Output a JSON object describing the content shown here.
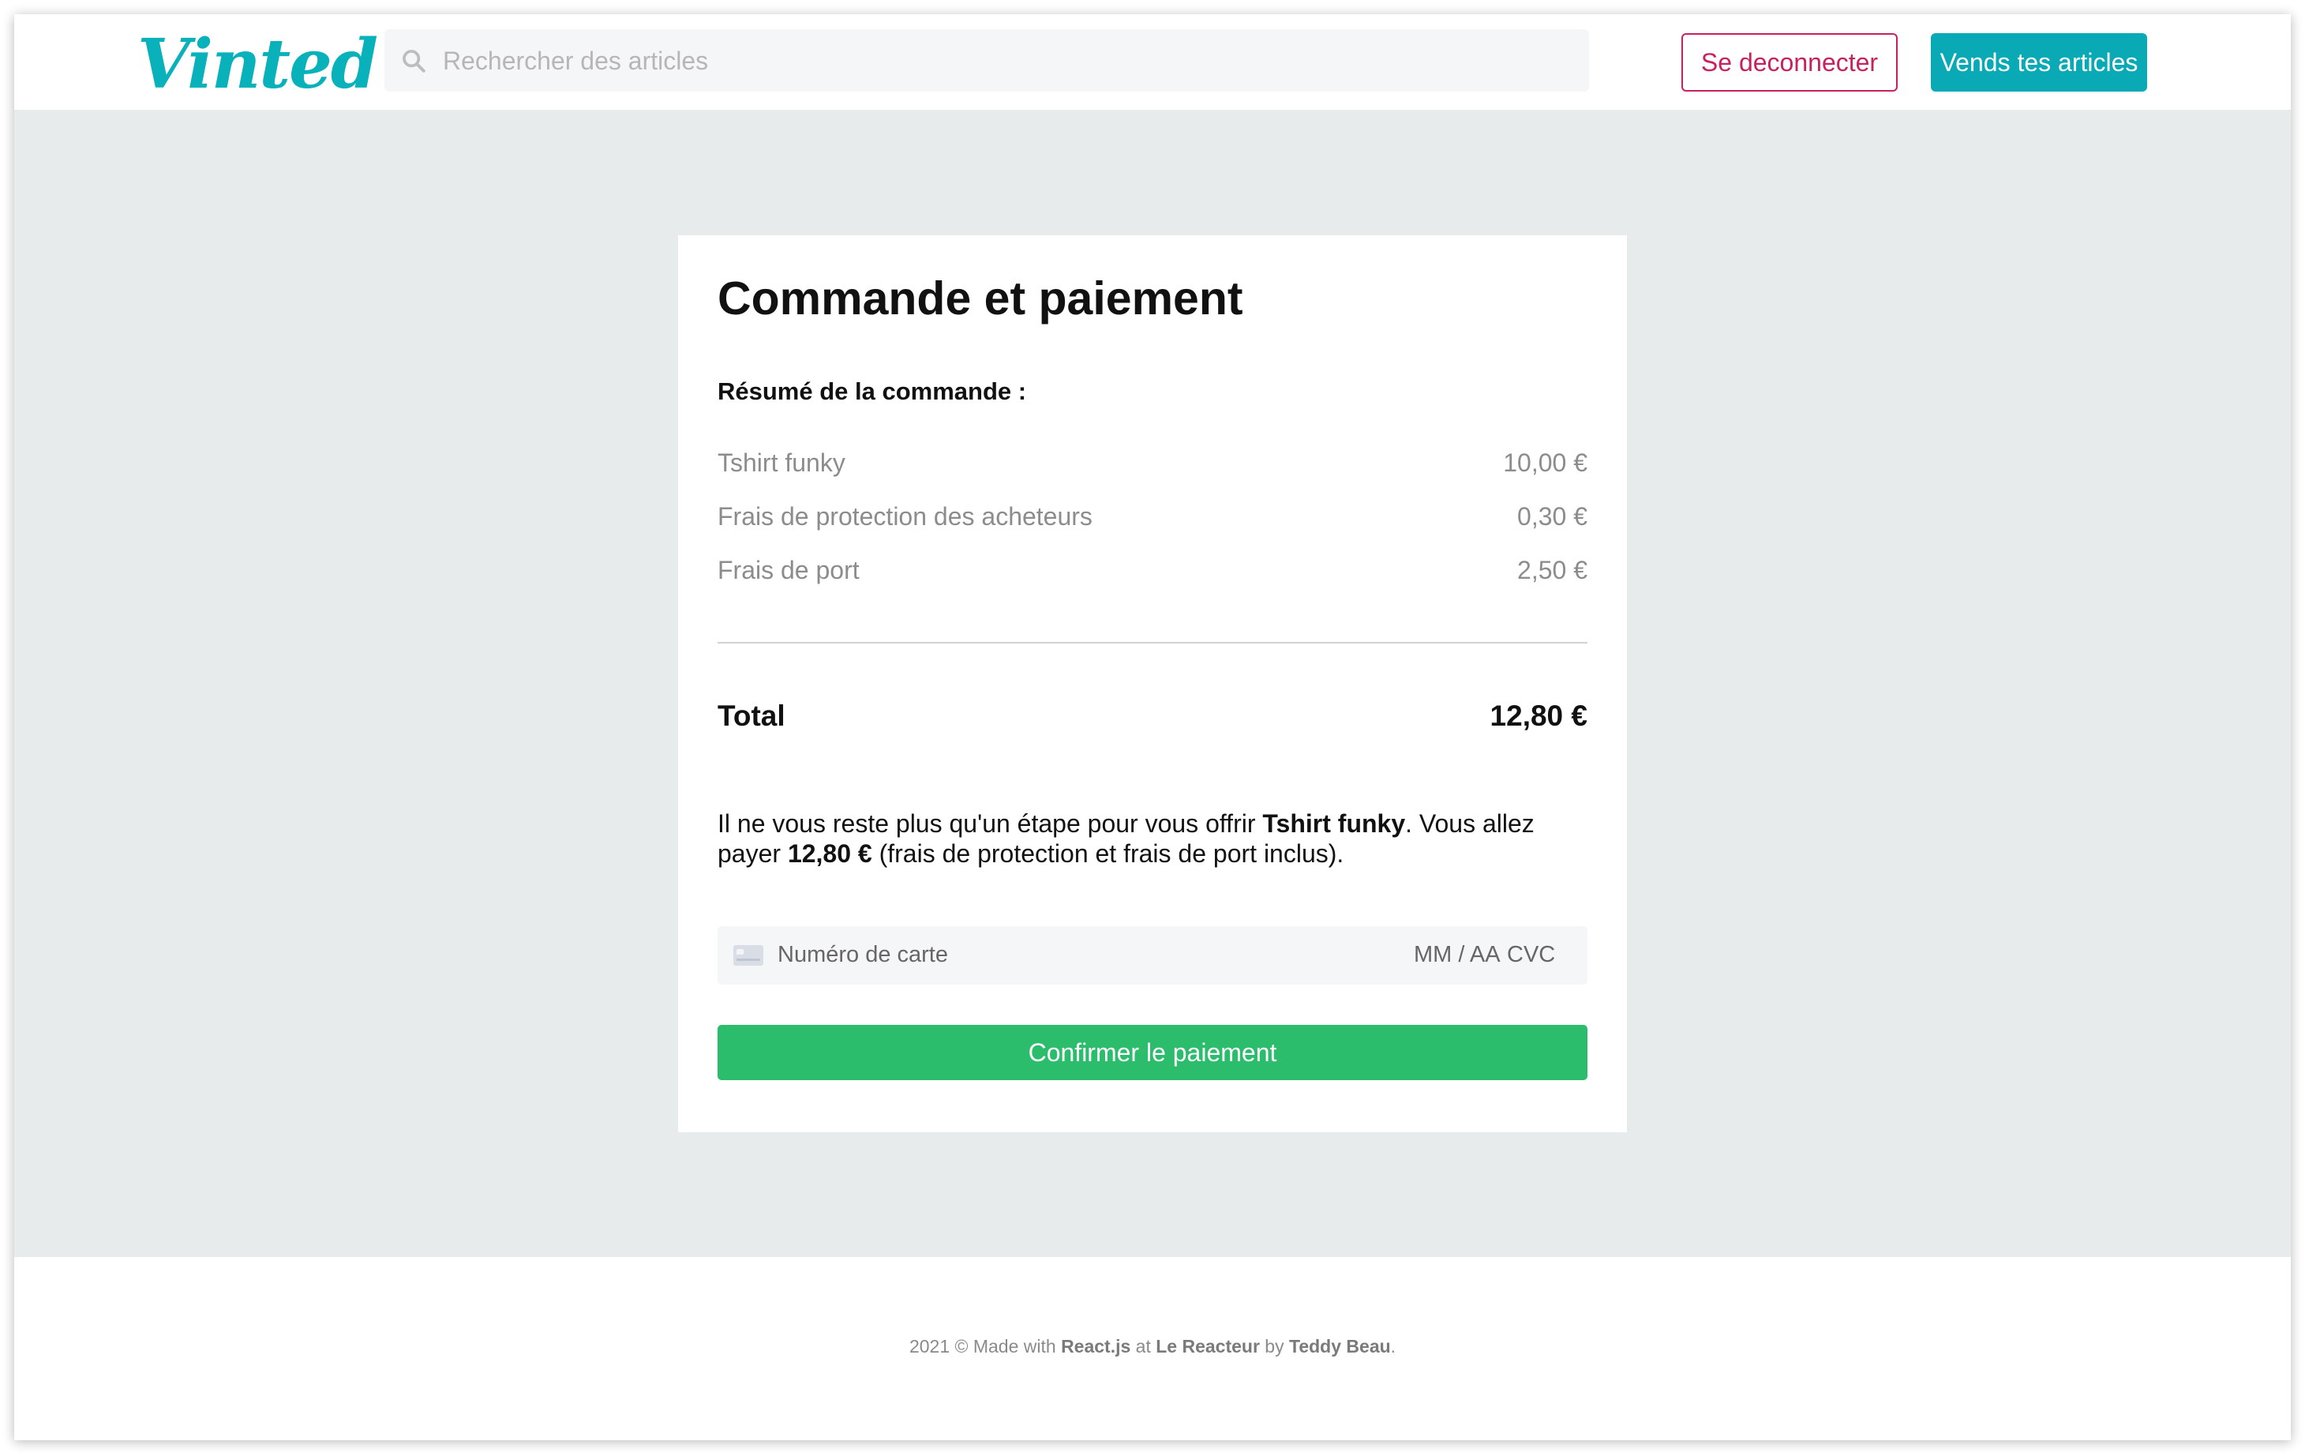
{
  "header": {
    "logo": "Vinted",
    "search_placeholder": "Rechercher des articles",
    "logout_label": "Se deconnecter",
    "sell_label": "Vends tes articles",
    "icons": {
      "search": "search-icon"
    }
  },
  "checkout": {
    "title": "Commande et paiement",
    "summary_title": "Résumé de la commande :",
    "items": [
      {
        "label": "Tshirt funky",
        "value": "10,00 €"
      },
      {
        "label": "Frais de protection des acheteurs",
        "value": "0,30 €"
      },
      {
        "label": "Frais de port",
        "value": "2,50 €"
      }
    ],
    "total_label": "Total",
    "total_value": "12,80 €",
    "message": {
      "part1": "Il ne vous reste plus qu'un étape pour vous offrir ",
      "product": "Tshirt funky",
      "part2": ". Vous allez payer ",
      "amount": "12,80 €",
      "part3": " (frais de protection et frais de port inclus)."
    },
    "card_field": {
      "number_placeholder": "Numéro de carte",
      "exp_placeholder": "MM / AA",
      "cvc_placeholder": "CVC",
      "icon": "credit-card-icon"
    },
    "confirm_label": "Confirmer le paiement"
  },
  "footer": {
    "prefix": "2021 © Made with ",
    "tech": "React.js",
    "at": " at ",
    "school": "Le Reacteur",
    "by": " by ",
    "author": "Teddy Beau",
    "suffix": "."
  },
  "colors": {
    "brand": "#09b1ba",
    "logout": "#c8225e",
    "confirm": "#2bbd6b",
    "background": "#e8ebeb"
  }
}
